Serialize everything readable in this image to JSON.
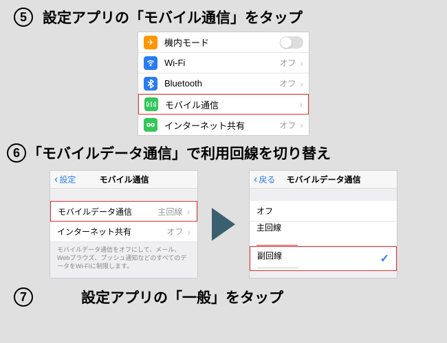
{
  "steps": {
    "s5": {
      "num": "5",
      "title": "設定アプリの「モバイル通信」をタップ"
    },
    "s6": {
      "num": "6",
      "title": "「モバイルデータ通信」で利用回線を切り替え"
    },
    "s7": {
      "num": "7",
      "title": "設定アプリの「一般」をタップ"
    }
  },
  "panel5": {
    "rows": [
      {
        "label": "機内モード",
        "val": ""
      },
      {
        "label": "Wi-Fi",
        "val": "オフ"
      },
      {
        "label": "Bluetooth",
        "val": "オフ"
      },
      {
        "label": "モバイル通信",
        "val": ""
      },
      {
        "label": "インターネット共有",
        "val": "オフ"
      }
    ]
  },
  "panel6a": {
    "back": "設定",
    "title": "モバイル通信",
    "rows": [
      {
        "label": "モバイルデータ通信",
        "val": "主回線"
      },
      {
        "label": "インターネット共有",
        "val": "オフ"
      }
    ],
    "note": "モバイルデータ通信をオフにして、メール、Webブラウズ、プッシュ通知などのすべてのデータをWi-Fiに制限します。"
  },
  "panel6b": {
    "back": "戻る",
    "title": "モバイルデータ通信",
    "rows": [
      {
        "label": "オフ"
      },
      {
        "label": "主回線"
      },
      {
        "label": "副回線"
      }
    ]
  }
}
